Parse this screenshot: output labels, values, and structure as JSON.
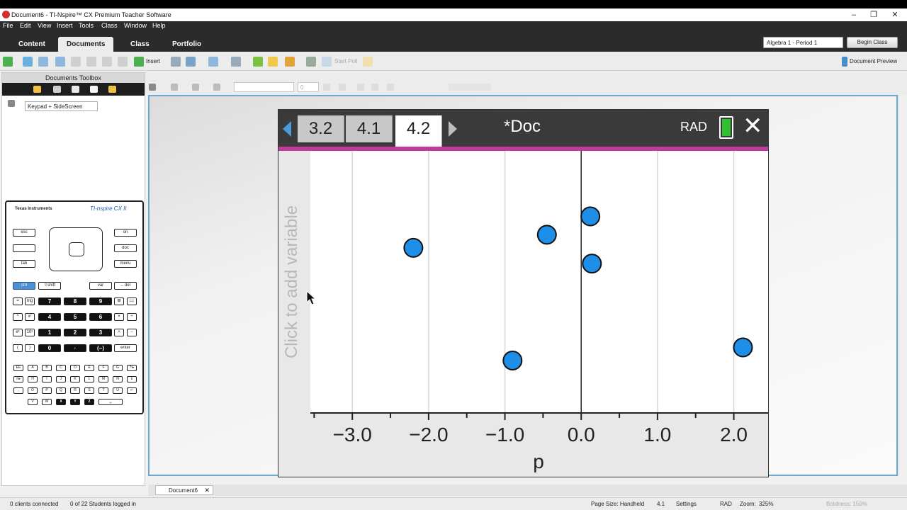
{
  "window": {
    "title": "Document6 - TI-Nspire™ CX Premium Teacher Software",
    "controls": [
      "–",
      "❐",
      "✕"
    ]
  },
  "menu": [
    "File",
    "Edit",
    "View",
    "Insert",
    "Tools",
    "Class",
    "Window",
    "Help"
  ],
  "workspace_tabs": [
    {
      "label": "Content",
      "active": false
    },
    {
      "label": "Documents",
      "active": true
    },
    {
      "label": "Class",
      "active": false
    },
    {
      "label": "Portfolio",
      "active": false
    }
  ],
  "class_select": "Algebra 1 - Period 1",
  "begin_class": "Begin Class",
  "toolbar": {
    "insert_label": "Insert",
    "start_poll_label": "Start Poll",
    "document_preview_label": "Document Preview",
    "font_size_value": "0"
  },
  "toolbox": {
    "title": "Documents Toolbox",
    "keypad_select": "Keypad + SideScreen"
  },
  "calculator": {
    "brand": "Texas Instruments",
    "model": "TI-nspire CX II",
    "keys": {
      "esc": "esc",
      "on": "on",
      "doc": "doc",
      "tab": "tab",
      "menu": "menu",
      "ctrl": "ctrl",
      "shift": "⇧shift",
      "var": "var",
      "del": "←del",
      "enter": "enter",
      "neg": "(−)",
      "dot": "·"
    },
    "digits": [
      "7",
      "8",
      "9",
      "4",
      "5",
      "6",
      "1",
      "2",
      "3",
      "0"
    ],
    "letters": [
      "EE",
      "A",
      "B",
      "C",
      "D",
      "E",
      "F",
      "G",
      "?!▸",
      "π▸",
      "H",
      "I",
      "J",
      "K",
      "L",
      "M",
      "N",
      "ℹ",
      ",",
      "O",
      "P",
      "Q",
      "R",
      "S",
      "T",
      "U",
      "↵",
      "V",
      "W",
      "X",
      "Y",
      "Z",
      "␣"
    ]
  },
  "handheld": {
    "page_tabs": [
      "3.2",
      "4.1",
      "4.2"
    ],
    "active_page": "4.2",
    "doc_name": "*Doc",
    "angle_mode": "RAD",
    "y_axis_prompt": "Click to add variable"
  },
  "chart_data": {
    "type": "scatter",
    "xlabel": "p",
    "ylabel": "",
    "xlim": [
      -3.55,
      2.45
    ],
    "ylim": [
      0,
      1
    ],
    "x_ticks": [
      -3.0,
      -2.0,
      -1.0,
      0.0,
      1.0,
      2.0
    ],
    "x_tick_labels": [
      "−3.0",
      "−2.0",
      "−1.0",
      "0.0",
      "1.0",
      "2.0"
    ],
    "points": [
      {
        "x": -2.2,
        "y": 0.63
      },
      {
        "x": -0.45,
        "y": 0.68
      },
      {
        "x": 0.12,
        "y": 0.75
      },
      {
        "x": 0.14,
        "y": 0.57
      },
      {
        "x": -0.9,
        "y": 0.2
      },
      {
        "x": 2.12,
        "y": 0.25
      }
    ],
    "point_color": "#1e8fe8",
    "grid": true
  },
  "doc_tab": "Document6",
  "status": {
    "clients": "0 clients connected",
    "students": "0 of 22 Students logged in",
    "page_size": "Page Size: Handheld",
    "page_num": "4.1",
    "settings": "Settings",
    "mode": "RAD",
    "zoom_label": "Zoom:",
    "zoom_value": "325%",
    "boldness": "Boldness: 150%"
  }
}
